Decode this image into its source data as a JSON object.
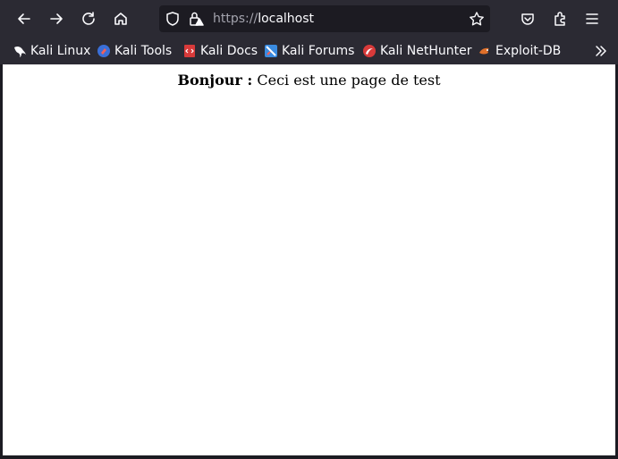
{
  "browser": {
    "url_scheme": "https://",
    "url_host": "localhost",
    "nav_icons": [
      "back-arrow-icon",
      "forward-arrow-icon",
      "reload-icon",
      "home-icon"
    ],
    "url_icons": [
      "shield-icon",
      "insecure-lock-icon",
      "star-icon"
    ],
    "right_icons": [
      "pocket-icon",
      "extensions-icon",
      "menu-icon"
    ]
  },
  "bookmarks": [
    {
      "label": "Kali Linux"
    },
    {
      "label": "Kali Tools"
    },
    {
      "label": "Kali Docs"
    },
    {
      "label": "Kali Forums"
    },
    {
      "label": "Kali NetHunter"
    },
    {
      "label": "Exploit-DB"
    }
  ],
  "page": {
    "bold_text": "Bonjour :",
    "body_text": " Ceci est une page de test"
  },
  "colors": {
    "toolbar_bg": "#2b2a33",
    "urlbar_bg": "#1c1b22",
    "text_light": "#fbfbfe",
    "content_bg": "#ffffff"
  }
}
